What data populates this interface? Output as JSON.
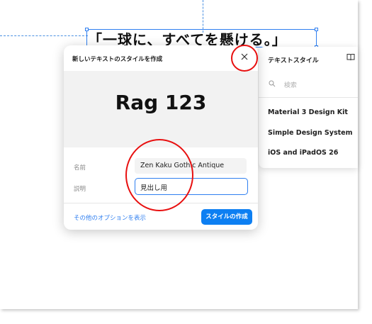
{
  "canvas": {
    "text": "「一球に、すべてを懸ける。」"
  },
  "dialog": {
    "title": "新しいテキストのスタイルを作成",
    "close_icon": "close-icon",
    "preview_text": "Rag 123",
    "name_label": "名前",
    "name_value": "Zen Kaku Gothic Antique",
    "description_label": "説明",
    "description_value": "見出し用",
    "more_options_link": "その他のオプションを表示",
    "create_button": "スタイルの作成"
  },
  "text_styles_panel": {
    "title": "テキストスタイル",
    "library_icon": "book-icon",
    "search_placeholder": "検索",
    "libraries": [
      "Material 3 Design Kit",
      "Simple Design System",
      "iOS and iPadOS 26"
    ]
  },
  "colors": {
    "accent": "#0d7ff2",
    "annotation": "#e81010",
    "selection": "#2f7ff0"
  }
}
